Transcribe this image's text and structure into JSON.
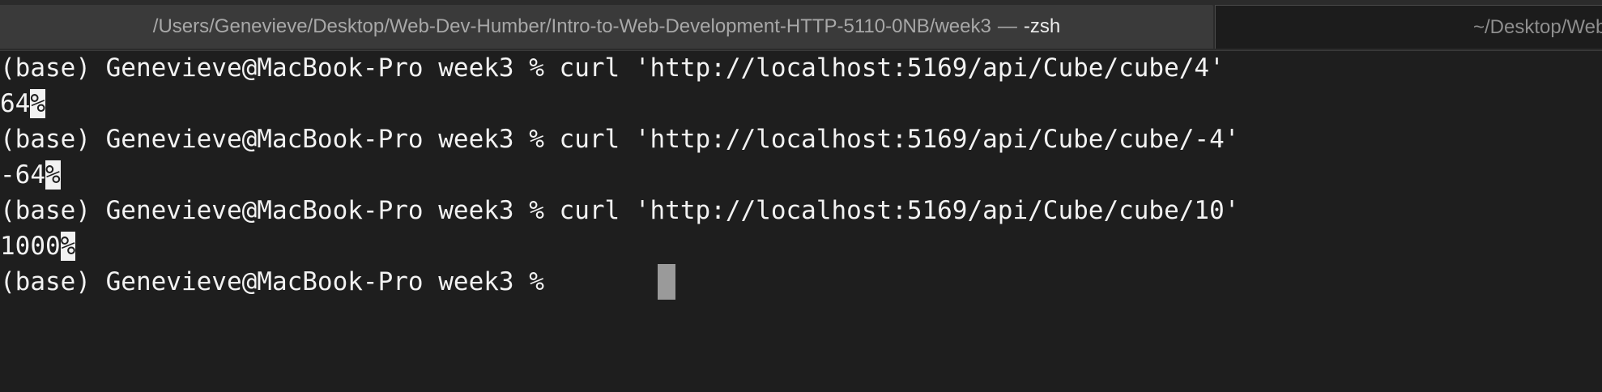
{
  "tabs": [
    {
      "path": "/Users/Genevieve/Desktop/Web-Dev-Humber/Intro-to-Web-Development-HTTP-5110-0NB/week3",
      "separator": "—",
      "process": "-zsh",
      "active": true
    },
    {
      "label": "~/Desktop/Web",
      "active": false
    }
  ],
  "terminal": {
    "lines": [
      {
        "text": "(base) Genevieve@MacBook-Pro week3 % curl 'http://localhost:5169/api/Cube/cube/4'"
      },
      {
        "text": "64",
        "eol": "%"
      },
      {
        "text": "(base) Genevieve@MacBook-Pro week3 % curl 'http://localhost:5169/api/Cube/cube/-4'"
      },
      {
        "text": "-64",
        "eol": "%"
      },
      {
        "text": "(base) Genevieve@MacBook-Pro week3 % curl 'http://localhost:5169/api/Cube/cube/10'"
      },
      {
        "text": "1000",
        "eol": "%"
      },
      {
        "text": "(base) Genevieve@MacBook-Pro week3 % "
      }
    ]
  },
  "colors": {
    "background": "#1e1e1e",
    "text": "#f2f2f2",
    "cursor": "#9a9a9a",
    "tabbar": "#2b2b2b",
    "active_tab": "#3a3a3a"
  }
}
